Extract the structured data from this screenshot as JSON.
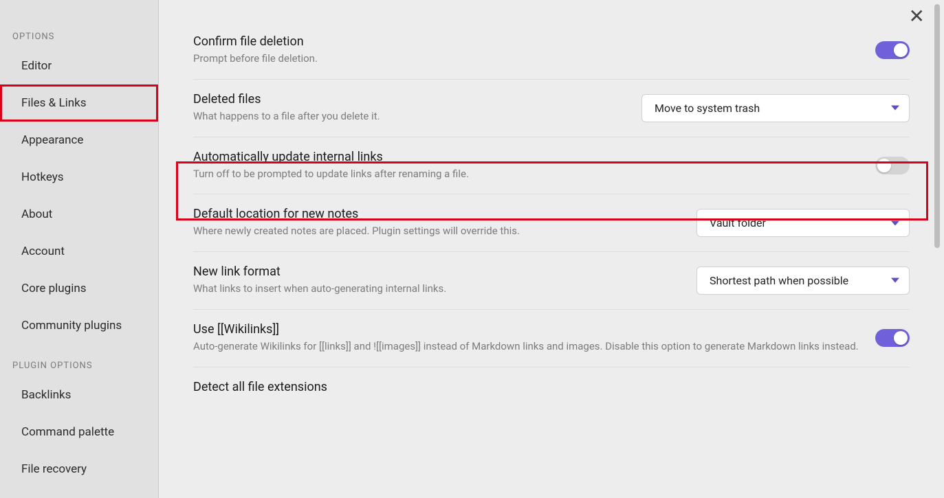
{
  "sidebar": {
    "sections": [
      {
        "title": "OPTIONS",
        "items": [
          {
            "label": "Editor",
            "active": false
          },
          {
            "label": "Files & Links",
            "active": true
          },
          {
            "label": "Appearance",
            "active": false
          },
          {
            "label": "Hotkeys",
            "active": false
          },
          {
            "label": "About",
            "active": false
          },
          {
            "label": "Account",
            "active": false
          },
          {
            "label": "Core plugins",
            "active": false
          },
          {
            "label": "Community plugins",
            "active": false
          }
        ]
      },
      {
        "title": "PLUGIN OPTIONS",
        "items": [
          {
            "label": "Backlinks",
            "active": false
          },
          {
            "label": "Command palette",
            "active": false
          },
          {
            "label": "File recovery",
            "active": false
          }
        ]
      }
    ]
  },
  "settings": {
    "confirm_delete": {
      "title": "Confirm file deletion",
      "desc": "Prompt before file deletion.",
      "toggle": true
    },
    "deleted_files": {
      "title": "Deleted files",
      "desc": "What happens to a file after you delete it.",
      "select_value": "Move to system trash"
    },
    "auto_update_links": {
      "title": "Automatically update internal links",
      "desc": "Turn off to be prompted to update links after renaming a file.",
      "toggle": false
    },
    "default_location": {
      "title": "Default location for new notes",
      "desc": "Where newly created notes are placed. Plugin settings will override this.",
      "select_value": "Vault folder"
    },
    "link_format": {
      "title": "New link format",
      "desc": "What links to insert when auto-generating internal links.",
      "select_value": "Shortest path when possible"
    },
    "wikilinks": {
      "title": "Use [[Wikilinks]]",
      "desc": "Auto-generate Wikilinks for [[links]] and ![[images]] instead of Markdown links and images. Disable this option to generate Markdown links instead.",
      "toggle": true
    },
    "detect_ext": {
      "title": "Detect all file extensions"
    }
  },
  "colors": {
    "accent": "#7061db",
    "highlight": "#d9001b"
  }
}
